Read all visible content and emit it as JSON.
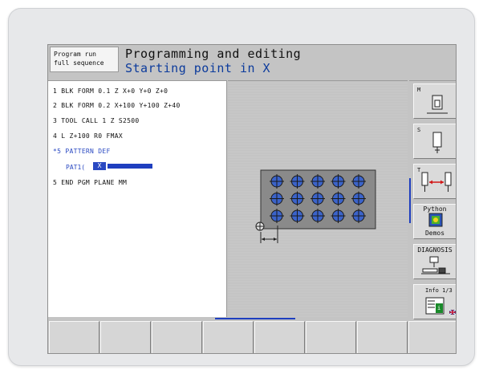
{
  "header": {
    "mode_line1": "Program run",
    "mode_line2": "full sequence",
    "title": "Programming and editing",
    "subtitle": "Starting point in X"
  },
  "program": {
    "lines": [
      {
        "text": "1  BLK FORM 0.1 Z  X+0  Y+0  Z+0",
        "active": false
      },
      {
        "text": "2  BLK FORM 0.2  X+100  Y+100  Z+40",
        "active": false
      },
      {
        "text": "3  TOOL CALL 1 Z S2500",
        "active": false
      },
      {
        "text": "4  L  Z+100 R0 FMAX",
        "active": false
      },
      {
        "text": "*5  PATTERN DEF",
        "active": true
      },
      {
        "text": "5  END PGM PLANE MM",
        "active": false
      }
    ],
    "pattern_label": "PAT1(",
    "pattern_axis": "X"
  },
  "graphic": {
    "pattern_rows": 3,
    "pattern_cols": 5
  },
  "softkeys_right": [
    {
      "label": "M",
      "icon": "machine-mode-icon"
    },
    {
      "label": "S",
      "icon": "spindle-icon"
    },
    {
      "label": "T",
      "icon": "tool-change-icon"
    },
    {
      "label": "Python\nDemos",
      "line1": "Python",
      "line2": "Demos",
      "icon": "python-icon"
    },
    {
      "label": "DIAGNOSIS",
      "icon": "diagnosis-icon"
    },
    {
      "label": "Info 1/3",
      "icon": "info-icon",
      "badge": "i"
    }
  ],
  "softkeys_bottom": [
    "",
    "",
    "",
    "",
    "",
    "",
    "",
    ""
  ],
  "colors": {
    "accent": "#1f3fbf",
    "hole_fill": "#3b63c9",
    "part_fill": "#8a8a8a"
  }
}
